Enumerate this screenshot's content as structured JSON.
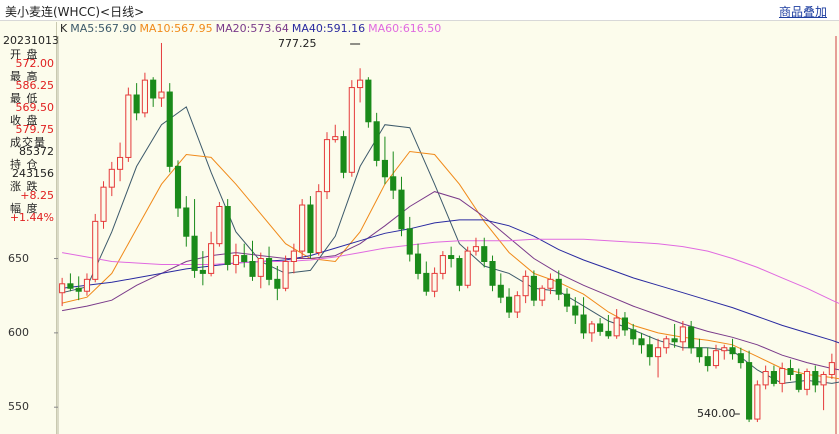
{
  "window": {
    "title": "美小麦连(WHCC)<日线>",
    "overlay_link": "商品叠加"
  },
  "colors": {
    "up": "#e53a3a",
    "down": "#1a8a1a",
    "ma5": "#3d5a6b",
    "ma10": "#f08a1a",
    "ma20": "#7a3a8a",
    "ma40": "#2a2aa0",
    "ma60": "#e06ae0"
  },
  "info_panel": {
    "date": "20231013",
    "rows": [
      {
        "label": "开 盘",
        "value": "572.00",
        "color": "#e02020"
      },
      {
        "label": "最 高",
        "value": "586.25",
        "color": "#e02020"
      },
      {
        "label": "最 低",
        "value": "569.50",
        "color": "#e02020"
      },
      {
        "label": "收 盘",
        "value": "579.75",
        "color": "#e02020"
      },
      {
        "label": "成交量",
        "value": "85372",
        "color": "#222222"
      },
      {
        "label": "持 仓",
        "value": "243156",
        "color": "#222222"
      },
      {
        "label": "涨 跌",
        "value": "+8.25",
        "color": "#e02020"
      },
      {
        "label": "幅 度",
        "value": "+1.44%",
        "color": "#e02020"
      }
    ]
  },
  "legend": [
    {
      "text": "K",
      "color": "#222222"
    },
    {
      "text": "MA5:567.90",
      "color": "#3d5a6b"
    },
    {
      "text": "MA10:567.95",
      "color": "#f08a1a"
    },
    {
      "text": "MA20:573.64",
      "color": "#7a3a8a"
    },
    {
      "text": "MA40:591.16",
      "color": "#2a2aa0"
    },
    {
      "text": "MA60:616.50",
      "color": "#e06ae0"
    }
  ],
  "y_axis": {
    "ticks": [
      "650",
      "600",
      "550"
    ],
    "tick_values": [
      650,
      600,
      550
    ],
    "range": [
      536,
      797
    ]
  },
  "markers": {
    "high_label": "777.25",
    "low_label": "540.00"
  },
  "chart_data": {
    "type": "candlestick",
    "ylim": [
      536,
      797
    ],
    "candles": [
      {
        "o": 627,
        "h": 637,
        "l": 618,
        "c": 633
      },
      {
        "o": 633,
        "h": 640,
        "l": 628,
        "c": 630
      },
      {
        "o": 630,
        "h": 638,
        "l": 622,
        "c": 628
      },
      {
        "o": 628,
        "h": 640,
        "l": 625,
        "c": 636
      },
      {
        "o": 636,
        "h": 680,
        "l": 634,
        "c": 675
      },
      {
        "o": 675,
        "h": 702,
        "l": 670,
        "c": 698
      },
      {
        "o": 698,
        "h": 715,
        "l": 692,
        "c": 710
      },
      {
        "o": 710,
        "h": 728,
        "l": 702,
        "c": 718
      },
      {
        "o": 718,
        "h": 765,
        "l": 715,
        "c": 760
      },
      {
        "o": 760,
        "h": 768,
        "l": 743,
        "c": 748
      },
      {
        "o": 748,
        "h": 775,
        "l": 745,
        "c": 770
      },
      {
        "o": 770,
        "h": 772,
        "l": 752,
        "c": 758
      },
      {
        "o": 758,
        "h": 795,
        "l": 752,
        "c": 762
      },
      {
        "o": 762,
        "h": 768,
        "l": 708,
        "c": 712
      },
      {
        "o": 712,
        "h": 716,
        "l": 678,
        "c": 684
      },
      {
        "o": 684,
        "h": 692,
        "l": 658,
        "c": 665
      },
      {
        "o": 665,
        "h": 690,
        "l": 637,
        "c": 642
      },
      {
        "o": 642,
        "h": 655,
        "l": 632,
        "c": 640
      },
      {
        "o": 640,
        "h": 668,
        "l": 638,
        "c": 660
      },
      {
        "o": 660,
        "h": 688,
        "l": 658,
        "c": 685
      },
      {
        "o": 685,
        "h": 690,
        "l": 642,
        "c": 646
      },
      {
        "o": 646,
        "h": 660,
        "l": 640,
        "c": 652
      },
      {
        "o": 652,
        "h": 660,
        "l": 644,
        "c": 648
      },
      {
        "o": 648,
        "h": 662,
        "l": 635,
        "c": 638
      },
      {
        "o": 638,
        "h": 654,
        "l": 630,
        "c": 650
      },
      {
        "o": 650,
        "h": 658,
        "l": 632,
        "c": 636
      },
      {
        "o": 636,
        "h": 645,
        "l": 622,
        "c": 630
      },
      {
        "o": 630,
        "h": 652,
        "l": 628,
        "c": 648
      },
      {
        "o": 648,
        "h": 660,
        "l": 640,
        "c": 655
      },
      {
        "o": 655,
        "h": 690,
        "l": 650,
        "c": 686
      },
      {
        "o": 686,
        "h": 692,
        "l": 650,
        "c": 654
      },
      {
        "o": 654,
        "h": 700,
        "l": 652,
        "c": 695
      },
      {
        "o": 695,
        "h": 735,
        "l": 690,
        "c": 730
      },
      {
        "o": 730,
        "h": 740,
        "l": 728,
        "c": 732
      },
      {
        "o": 732,
        "h": 736,
        "l": 704,
        "c": 708
      },
      {
        "o": 708,
        "h": 770,
        "l": 705,
        "c": 765
      },
      {
        "o": 765,
        "h": 778,
        "l": 755,
        "c": 770
      },
      {
        "o": 770,
        "h": 772,
        "l": 738,
        "c": 742
      },
      {
        "o": 742,
        "h": 748,
        "l": 712,
        "c": 716
      },
      {
        "o": 716,
        "h": 732,
        "l": 700,
        "c": 705
      },
      {
        "o": 705,
        "h": 722,
        "l": 690,
        "c": 696
      },
      {
        "o": 696,
        "h": 705,
        "l": 665,
        "c": 670
      },
      {
        "o": 670,
        "h": 678,
        "l": 648,
        "c": 653
      },
      {
        "o": 653,
        "h": 660,
        "l": 636,
        "c": 640
      },
      {
        "o": 640,
        "h": 648,
        "l": 625,
        "c": 628
      },
      {
        "o": 628,
        "h": 644,
        "l": 624,
        "c": 640
      },
      {
        "o": 640,
        "h": 655,
        "l": 636,
        "c": 652
      },
      {
        "o": 652,
        "h": 658,
        "l": 644,
        "c": 650
      },
      {
        "o": 650,
        "h": 652,
        "l": 628,
        "c": 632
      },
      {
        "o": 632,
        "h": 658,
        "l": 630,
        "c": 655
      },
      {
        "o": 655,
        "h": 664,
        "l": 652,
        "c": 658
      },
      {
        "o": 658,
        "h": 664,
        "l": 644,
        "c": 648
      },
      {
        "o": 648,
        "h": 652,
        "l": 628,
        "c": 632
      },
      {
        "o": 632,
        "h": 640,
        "l": 620,
        "c": 624
      },
      {
        "o": 624,
        "h": 630,
        "l": 610,
        "c": 614
      },
      {
        "o": 614,
        "h": 628,
        "l": 610,
        "c": 625
      },
      {
        "o": 625,
        "h": 642,
        "l": 620,
        "c": 638
      },
      {
        "o": 638,
        "h": 642,
        "l": 618,
        "c": 622
      },
      {
        "o": 622,
        "h": 632,
        "l": 618,
        "c": 630
      },
      {
        "o": 630,
        "h": 640,
        "l": 626,
        "c": 636
      },
      {
        "o": 636,
        "h": 642,
        "l": 622,
        "c": 626
      },
      {
        "o": 626,
        "h": 630,
        "l": 614,
        "c": 618
      },
      {
        "o": 618,
        "h": 624,
        "l": 606,
        "c": 612
      },
      {
        "o": 612,
        "h": 624,
        "l": 596,
        "c": 600
      },
      {
        "o": 600,
        "h": 608,
        "l": 594,
        "c": 606
      },
      {
        "o": 606,
        "h": 610,
        "l": 598,
        "c": 601
      },
      {
        "o": 601,
        "h": 612,
        "l": 596,
        "c": 598
      },
      {
        "o": 598,
        "h": 616,
        "l": 596,
        "c": 610
      },
      {
        "o": 610,
        "h": 614,
        "l": 598,
        "c": 602
      },
      {
        "o": 602,
        "h": 606,
        "l": 592,
        "c": 596
      },
      {
        "o": 596,
        "h": 600,
        "l": 586,
        "c": 592
      },
      {
        "o": 592,
        "h": 598,
        "l": 578,
        "c": 584
      },
      {
        "o": 584,
        "h": 596,
        "l": 570,
        "c": 590
      },
      {
        "o": 590,
        "h": 598,
        "l": 586,
        "c": 596
      },
      {
        "o": 596,
        "h": 606,
        "l": 590,
        "c": 594
      },
      {
        "o": 594,
        "h": 608,
        "l": 588,
        "c": 604
      },
      {
        "o": 604,
        "h": 608,
        "l": 586,
        "c": 590
      },
      {
        "o": 590,
        "h": 596,
        "l": 580,
        "c": 584
      },
      {
        "o": 584,
        "h": 590,
        "l": 574,
        "c": 578
      },
      {
        "o": 578,
        "h": 592,
        "l": 576,
        "c": 588
      },
      {
        "o": 588,
        "h": 592,
        "l": 582,
        "c": 590
      },
      {
        "o": 590,
        "h": 596,
        "l": 582,
        "c": 586
      },
      {
        "o": 586,
        "h": 590,
        "l": 576,
        "c": 580
      },
      {
        "o": 580,
        "h": 588,
        "l": 540,
        "c": 542
      },
      {
        "o": 542,
        "h": 568,
        "l": 540,
        "c": 565
      },
      {
        "o": 565,
        "h": 578,
        "l": 562,
        "c": 574
      },
      {
        "o": 574,
        "h": 578,
        "l": 564,
        "c": 566
      },
      {
        "o": 566,
        "h": 580,
        "l": 560,
        "c": 576
      },
      {
        "o": 576,
        "h": 582,
        "l": 568,
        "c": 572
      },
      {
        "o": 572,
        "h": 576,
        "l": 560,
        "c": 562
      },
      {
        "o": 562,
        "h": 576,
        "l": 558,
        "c": 574
      },
      {
        "o": 574,
        "h": 578,
        "l": 560,
        "c": 565
      },
      {
        "o": 565,
        "h": 574,
        "l": 548,
        "c": 572
      },
      {
        "o": 572,
        "h": 586,
        "l": 569,
        "c": 580
      }
    ],
    "ma": [
      {
        "name": "MA5",
        "points": [
          [
            0,
            627
          ],
          [
            3,
            631
          ],
          [
            6,
            668
          ],
          [
            9,
            712
          ],
          [
            12,
            740
          ],
          [
            15,
            752
          ],
          [
            18,
            708
          ],
          [
            21,
            668
          ],
          [
            24,
            648
          ],
          [
            27,
            640
          ],
          [
            30,
            642
          ],
          [
            33,
            665
          ],
          [
            36,
            712
          ],
          [
            39,
            740
          ],
          [
            42,
            738
          ],
          [
            45,
            700
          ],
          [
            48,
            660
          ],
          [
            51,
            645
          ],
          [
            54,
            640
          ],
          [
            57,
            630
          ],
          [
            60,
            628
          ],
          [
            63,
            618
          ],
          [
            66,
            608
          ],
          [
            69,
            602
          ],
          [
            72,
            595
          ],
          [
            75,
            590
          ],
          [
            78,
            590
          ],
          [
            81,
            588
          ],
          [
            84,
            575
          ],
          [
            87,
            566
          ],
          [
            90,
            568
          ],
          [
            93,
            566
          ],
          [
            95,
            568
          ]
        ]
      },
      {
        "name": "MA10",
        "points": [
          [
            0,
            620
          ],
          [
            3,
            624
          ],
          [
            6,
            640
          ],
          [
            9,
            670
          ],
          [
            12,
            700
          ],
          [
            15,
            720
          ],
          [
            18,
            718
          ],
          [
            21,
            700
          ],
          [
            24,
            680
          ],
          [
            27,
            660
          ],
          [
            30,
            650
          ],
          [
            33,
            648
          ],
          [
            36,
            668
          ],
          [
            39,
            700
          ],
          [
            42,
            722
          ],
          [
            45,
            720
          ],
          [
            48,
            700
          ],
          [
            51,
            675
          ],
          [
            54,
            654
          ],
          [
            57,
            640
          ],
          [
            60,
            634
          ],
          [
            63,
            626
          ],
          [
            66,
            614
          ],
          [
            69,
            605
          ],
          [
            72,
            600
          ],
          [
            75,
            597
          ],
          [
            78,
            595
          ],
          [
            81,
            592
          ],
          [
            84,
            584
          ],
          [
            87,
            576
          ],
          [
            90,
            572
          ],
          [
            93,
            570
          ],
          [
            95,
            568
          ]
        ]
      },
      {
        "name": "MA20",
        "points": [
          [
            0,
            615
          ],
          [
            3,
            618
          ],
          [
            6,
            622
          ],
          [
            9,
            632
          ],
          [
            12,
            640
          ],
          [
            15,
            648
          ],
          [
            18,
            652
          ],
          [
            21,
            654
          ],
          [
            24,
            652
          ],
          [
            27,
            650
          ],
          [
            30,
            650
          ],
          [
            33,
            652
          ],
          [
            36,
            660
          ],
          [
            39,
            672
          ],
          [
            42,
            685
          ],
          [
            45,
            695
          ],
          [
            48,
            690
          ],
          [
            51,
            678
          ],
          [
            54,
            664
          ],
          [
            57,
            650
          ],
          [
            60,
            640
          ],
          [
            63,
            632
          ],
          [
            66,
            625
          ],
          [
            69,
            618
          ],
          [
            72,
            612
          ],
          [
            75,
            606
          ],
          [
            78,
            601
          ],
          [
            81,
            597
          ],
          [
            84,
            592
          ],
          [
            87,
            585
          ],
          [
            90,
            580
          ],
          [
            93,
            576
          ],
          [
            95,
            574
          ]
        ]
      },
      {
        "name": "MA40",
        "points": [
          [
            0,
            630
          ],
          [
            3,
            632
          ],
          [
            6,
            634
          ],
          [
            9,
            637
          ],
          [
            12,
            640
          ],
          [
            15,
            643
          ],
          [
            18,
            645
          ],
          [
            21,
            647
          ],
          [
            24,
            648
          ],
          [
            27,
            649
          ],
          [
            30,
            652
          ],
          [
            33,
            657
          ],
          [
            36,
            662
          ],
          [
            39,
            667
          ],
          [
            42,
            670
          ],
          [
            45,
            674
          ],
          [
            48,
            676
          ],
          [
            51,
            676
          ],
          [
            54,
            672
          ],
          [
            57,
            665
          ],
          [
            60,
            656
          ],
          [
            63,
            649
          ],
          [
            66,
            643
          ],
          [
            69,
            637
          ],
          [
            72,
            632
          ],
          [
            75,
            627
          ],
          [
            78,
            622
          ],
          [
            81,
            617
          ],
          [
            84,
            611
          ],
          [
            87,
            605
          ],
          [
            90,
            600
          ],
          [
            93,
            595
          ],
          [
            95,
            591
          ]
        ]
      },
      {
        "name": "MA60",
        "points": [
          [
            0,
            654
          ],
          [
            3,
            651
          ],
          [
            6,
            648
          ],
          [
            9,
            647
          ],
          [
            12,
            646
          ],
          [
            15,
            646
          ],
          [
            18,
            646
          ],
          [
            21,
            647
          ],
          [
            24,
            648
          ],
          [
            27,
            648
          ],
          [
            30,
            649
          ],
          [
            33,
            651
          ],
          [
            36,
            654
          ],
          [
            39,
            657
          ],
          [
            42,
            659
          ],
          [
            45,
            661
          ],
          [
            48,
            662
          ],
          [
            51,
            662
          ],
          [
            54,
            662
          ],
          [
            57,
            663
          ],
          [
            60,
            663
          ],
          [
            63,
            663
          ],
          [
            66,
            662
          ],
          [
            69,
            661
          ],
          [
            72,
            660
          ],
          [
            75,
            658
          ],
          [
            78,
            655
          ],
          [
            81,
            650
          ],
          [
            84,
            644
          ],
          [
            87,
            637
          ],
          [
            90,
            630
          ],
          [
            93,
            622
          ],
          [
            95,
            617
          ]
        ]
      }
    ]
  }
}
